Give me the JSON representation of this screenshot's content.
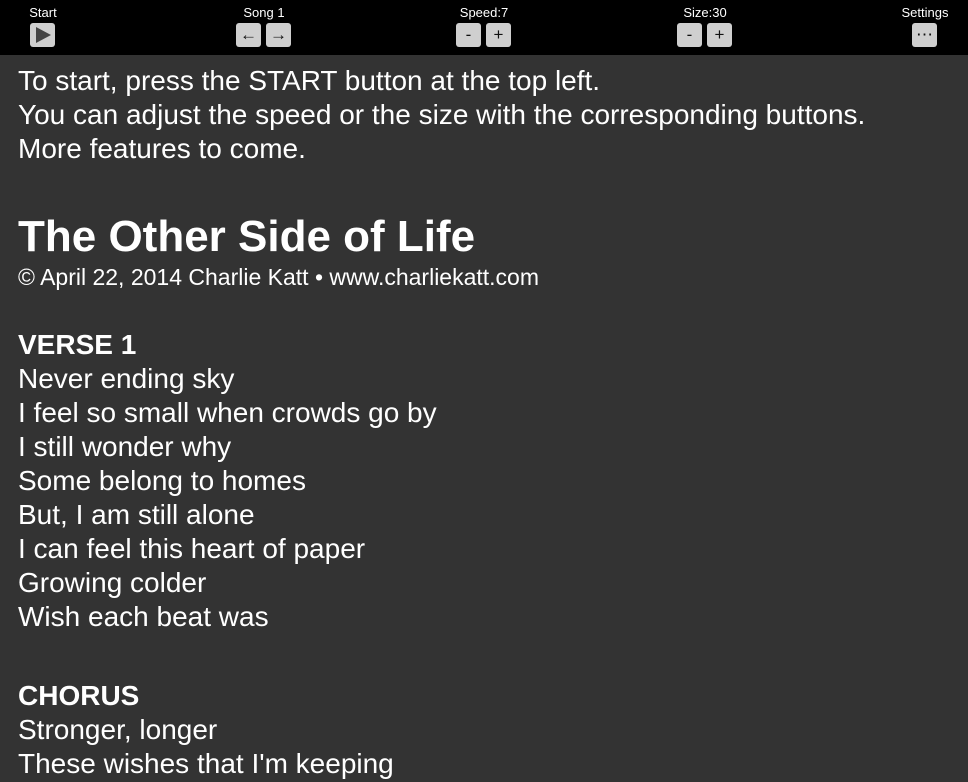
{
  "toolbar": {
    "start": {
      "label": "Start"
    },
    "song": {
      "label": "Song 1",
      "prev": "←",
      "next": "→"
    },
    "speed": {
      "label": "Speed:7",
      "minus": "-",
      "plus": "+"
    },
    "size": {
      "label": "Size:30",
      "minus": "-",
      "plus": "+"
    },
    "settings": {
      "label": "Settings",
      "more": "⋯"
    }
  },
  "intro": [
    "To start, press the START button at the top left.",
    "You can adjust the speed or the size with the corresponding buttons.",
    "More features to come."
  ],
  "song": {
    "title": "The Other Side of Life",
    "copyright": "© April 22, 2014 Charlie Katt • www.charliekatt.com",
    "sections": [
      {
        "title": "VERSE 1",
        "lines": [
          "Never ending sky",
          "I feel so small when crowds go by",
          "I still wonder why",
          "Some belong to homes",
          "But, I am still alone",
          "I can feel this heart of paper",
          "Growing colder",
          "Wish each beat was"
        ]
      },
      {
        "title": "CHORUS",
        "lines": [
          "Stronger, longer",
          "These wishes that I'm keeping"
        ]
      }
    ]
  }
}
